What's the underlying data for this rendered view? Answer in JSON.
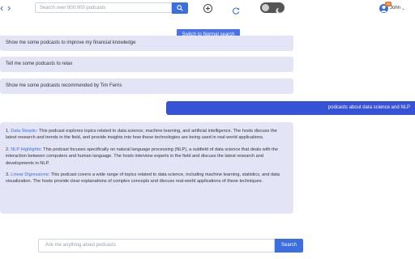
{
  "header": {
    "back_icon": "back-icon",
    "forward_icon": "forward-icon",
    "search_placeholder": "Search over 900,000 podcasts",
    "user_name": "John",
    "badge": "34",
    "colors": {
      "accent": "#3b6fe0",
      "user_bubble": "#3652d6",
      "bubble": "#e3e4f6",
      "badge": "#e8772e"
    }
  },
  "switch_button": "Switch to Normal search",
  "suggestions": [
    "Show me some podcasts to improve my financial knowledge",
    "Tell me some podcasts to relax",
    "Show me some podcasts recommended by Tim Ferris"
  ],
  "user_message": "podcasts about data science and NLP",
  "answer": [
    {
      "num": "1.",
      "name": "Data Skeptic",
      "text": ": This podcast explores topics related to data science, machine learning, and artificial intelligence. The hosts discuss the latest research and trends in the field, and provide insights into how these technologies are being used in real-world applications."
    },
    {
      "num": "2.",
      "name": "NLP Highlights",
      "text": ": This podcast focuses specifically on natural language processing (NLP), a subfield of data science that deals with the interaction between computers and human language. The hosts interview experts in the field and discuss the latest research and developments in NLP."
    },
    {
      "num": "3.",
      "name": "Linear Digressions",
      "text": ": This podcast covers a wide range of topics related to data science, including machine learning, statistics, and data visualization. The hosts provide clear explanations of complex concepts and discuss real-world applications of these techniques."
    }
  ],
  "ask": {
    "placeholder": "Ask me anything about podcasts",
    "button": "Search"
  }
}
